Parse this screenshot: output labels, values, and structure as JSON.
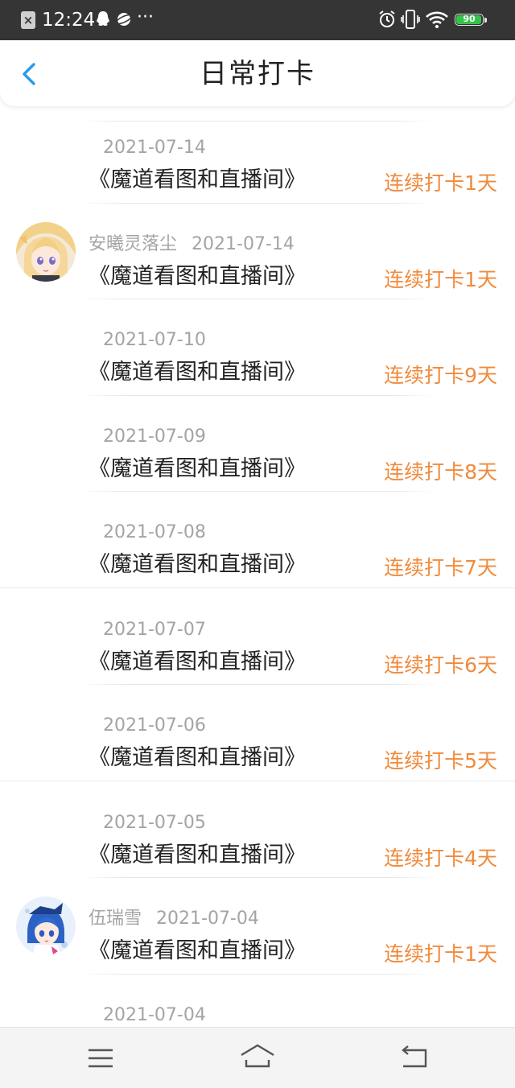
{
  "status_bar": {
    "time": "12:24",
    "battery": "90",
    "icons": [
      "close-notification-icon",
      "qq-icon",
      "planet-icon",
      "more-dots-icon",
      "alarm-icon",
      "vibrate-icon",
      "wifi-icon",
      "battery-icon"
    ],
    "more": "···"
  },
  "header": {
    "title": "日常打卡",
    "back_icon": "chevron-left-icon"
  },
  "accent_color": "#f08a3c",
  "back_color": "#2a9ae8",
  "checkins": [
    {
      "user": "",
      "date": "2021-07-14",
      "room": "《魔道看图和直播间》",
      "streak": "连续打卡1天",
      "avatar": false
    },
    {
      "user": "安曦灵落尘",
      "date": "2021-07-14",
      "room": "《魔道看图和直播间》",
      "streak": "连续打卡1天",
      "avatar": true
    },
    {
      "user": "",
      "date": "2021-07-10",
      "room": "《魔道看图和直播间》",
      "streak": "连续打卡9天",
      "avatar": false
    },
    {
      "user": "",
      "date": "2021-07-09",
      "room": "《魔道看图和直播间》",
      "streak": "连续打卡8天",
      "avatar": false
    },
    {
      "user": "",
      "date": "2021-07-08",
      "room": "《魔道看图和直播间》",
      "streak": "连续打卡7天",
      "avatar": false
    },
    {
      "user": "",
      "date": "2021-07-07",
      "room": "《魔道看图和直播间》",
      "streak": "连续打卡6天",
      "avatar": false
    },
    {
      "user": "",
      "date": "2021-07-06",
      "room": "《魔道看图和直播间》",
      "streak": "连续打卡5天",
      "avatar": false
    },
    {
      "user": "",
      "date": "2021-07-05",
      "room": "《魔道看图和直播间》",
      "streak": "连续打卡4天",
      "avatar": false
    },
    {
      "user": "伍瑞雪",
      "date": "2021-07-04",
      "room": "《魔道看图和直播间》",
      "streak": "连续打卡1天",
      "avatar": true
    },
    {
      "user": "",
      "date": "2021-07-04",
      "room": "",
      "streak": "",
      "avatar": false
    }
  ],
  "nav_bar": {
    "icons": [
      "menu-icon",
      "home-icon",
      "back-icon"
    ]
  }
}
